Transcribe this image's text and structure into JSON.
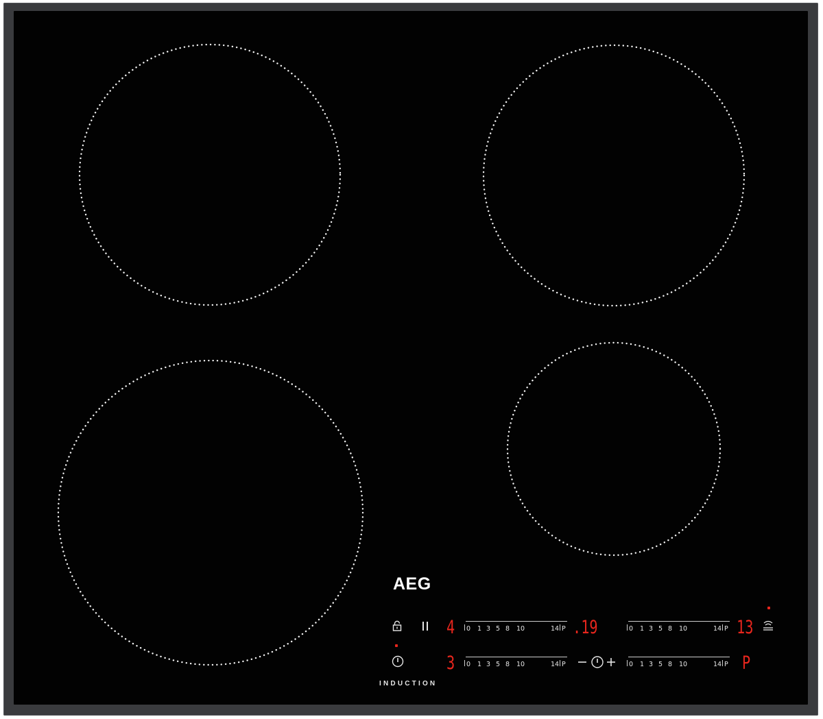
{
  "brand": "AEG",
  "label": "INDUCTION",
  "slider_ticks": [
    "0",
    "1",
    "3",
    "5",
    "8",
    "10",
    "14",
    "P"
  ],
  "displays": {
    "front_left": "4",
    "rear_left": "3",
    "timer": ".19",
    "front_right": "13",
    "rear_right": "P"
  },
  "colors": {
    "glass": "#020202",
    "frame": "#3a3b3e",
    "display_red": "#e8261d",
    "zone_markings": "#f2f2f2"
  },
  "icons": {
    "lock": "lock-icon",
    "pause": "pause-icon",
    "power": "power-icon",
    "timer": "timer-icon",
    "hob_hood": "hob-hood-icon"
  }
}
